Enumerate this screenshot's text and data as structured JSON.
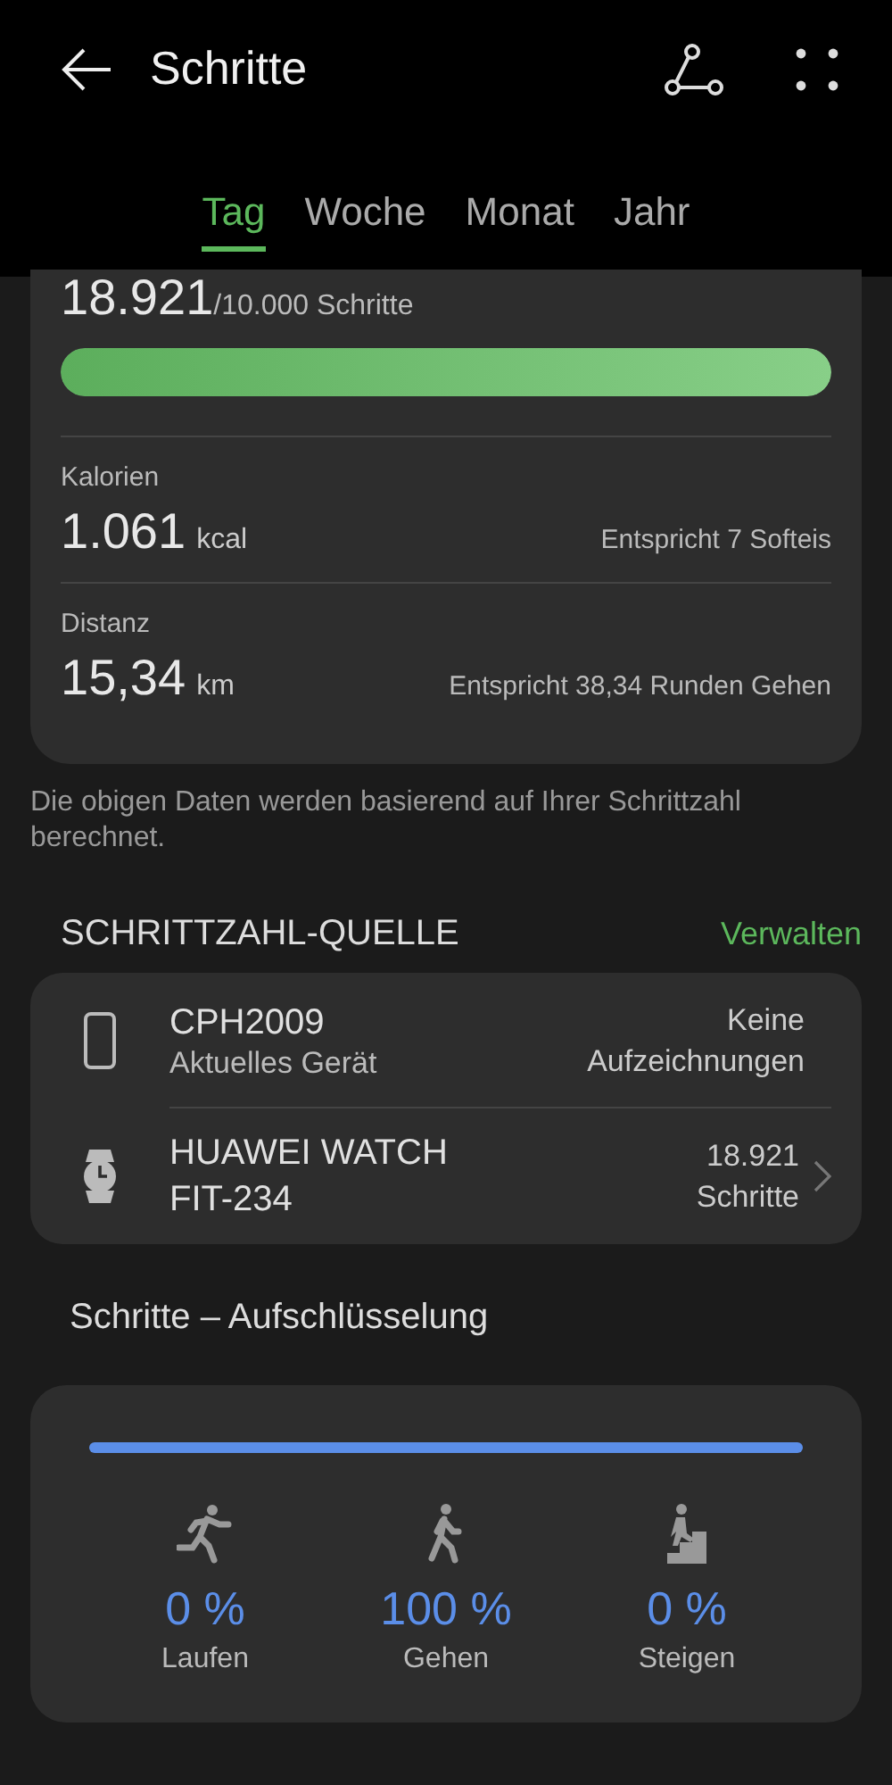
{
  "header": {
    "title": "Schritte"
  },
  "tabs": [
    {
      "label": "Tag",
      "selected": true
    },
    {
      "label": "Woche",
      "selected": false
    },
    {
      "label": "Monat",
      "selected": false
    },
    {
      "label": "Jahr",
      "selected": false
    }
  ],
  "summary": {
    "steps": "18.921",
    "goal": "/10.000 Schritte",
    "level": 1,
    "stats": [
      {
        "label": "Kalorien",
        "value": "1.061",
        "unit": "kcal",
        "equivalent": "Entspricht 7 Softeis"
      },
      {
        "label": "Distanz",
        "value": "15,34",
        "unit": "km",
        "equivalent": "Entspricht 38,34 Runden Gehen"
      }
    ]
  },
  "note": "Die obigen Daten werden basierend auf Ihrer Schrittzahl berechnet.",
  "sources": {
    "title": "SCHRITTZAHL-QUELLE",
    "action": "Verwalten",
    "items": [
      {
        "kind": "phone",
        "name": "CPH2009",
        "subtitle": "Aktuelles Gerät",
        "value": "Keine Aufzeichnungen",
        "chevron": false
      },
      {
        "kind": "watch",
        "name": "HUAWEI WATCH FIT-234",
        "value": "18.921 Schritte",
        "chevron": true
      }
    ]
  },
  "breakdown": {
    "title": "Schritte – Aufschlüsselung",
    "level": 1,
    "items": [
      {
        "kind": "run",
        "percent": "0 %",
        "label": "Laufen"
      },
      {
        "kind": "walk",
        "percent": "100 %",
        "label": "Gehen"
      },
      {
        "kind": "climb",
        "percent": "0 %",
        "label": "Steigen"
      }
    ]
  }
}
